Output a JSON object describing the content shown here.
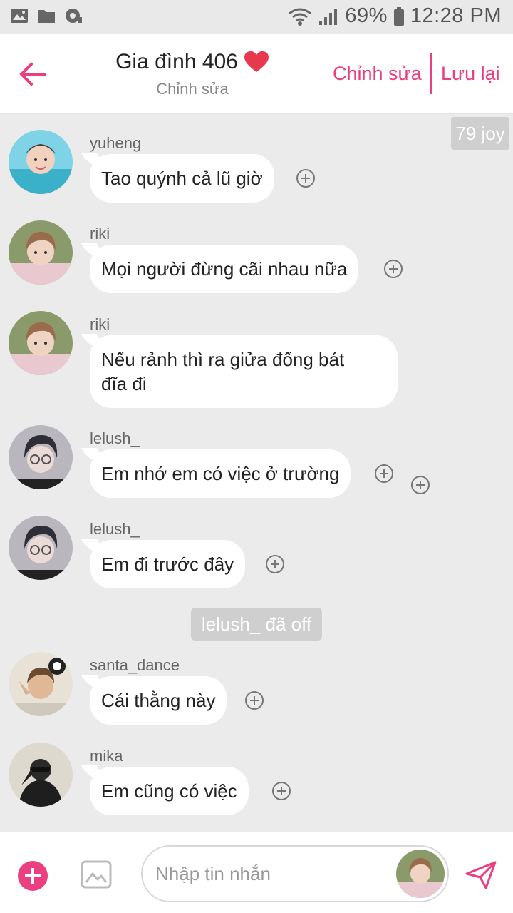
{
  "status_bar": {
    "battery": "69%",
    "time": "12:28 PM",
    "icons": [
      "image-icon",
      "folder-icon",
      "sync-icon",
      "wifi-icon",
      "signal-icon",
      "battery-icon"
    ]
  },
  "header": {
    "title": "Gia đình 406",
    "title_emoji": "heart-icon",
    "subtitle": "Chỉnh sửa",
    "edit_label": "Chỉnh sửa",
    "save_label": "Lưu lại",
    "accent_color": "#ec3f82"
  },
  "chat": {
    "viewer_badge": "79 joy",
    "messages": [
      {
        "sender": "yuheng",
        "text": "Tao quýnh cả lũ giờ"
      },
      {
        "sender": "riki",
        "text": "Mọi người đừng cãi nhau nữa"
      },
      {
        "sender": "riki",
        "text": "Nếu rảnh thì ra giửa đống bát",
        "text_line2": "đĩa đi"
      },
      {
        "sender": "lelush_",
        "text": "Em nhớ em có việc ở trường"
      },
      {
        "sender": "lelush_",
        "text": "Em đi trước đây"
      },
      {
        "sender": "santa_dance",
        "text": "Cái thằng này"
      },
      {
        "sender": "mika",
        "text": "Em cũng có việc"
      }
    ],
    "system_message": "lelush_ đã off"
  },
  "input_bar": {
    "placeholder": "Nhập tin nhắn"
  }
}
